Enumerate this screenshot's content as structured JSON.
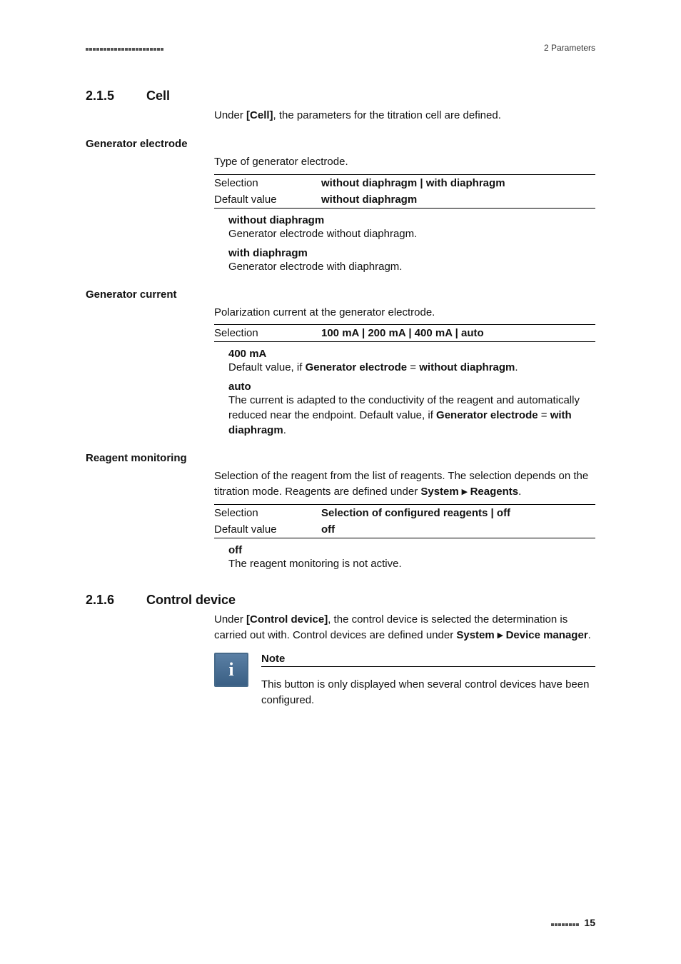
{
  "header": {
    "section_label": "2 Parameters"
  },
  "sections": [
    {
      "number": "2.1.5",
      "title": "Cell",
      "intro": "Under [Cell], the parameters for the titration cell are defined.",
      "intro_bold": "[Cell]",
      "params": [
        {
          "side_heading": "Generator electrode",
          "lead": "Type of generator electrode.",
          "rows": [
            {
              "label": "Selection",
              "value": "without diaphragm | with diaphragm"
            },
            {
              "label": "Default value",
              "value": "without diaphragm"
            }
          ],
          "defs": [
            {
              "term": "without diaphragm",
              "desc": "Generator electrode without diaphragm."
            },
            {
              "term": "with diaphragm",
              "desc": "Generator electrode with diaphragm."
            }
          ]
        },
        {
          "side_heading": "Generator current",
          "lead": "Polarization current at the generator electrode.",
          "rows": [
            {
              "label": "Selection",
              "value": "100 mA | 200 mA | 400 mA | auto"
            }
          ],
          "defs": [
            {
              "term": "400 mA",
              "desc_html": "Default value, if <b>Generator electrode</b> = <b>without diaphragm</b>."
            },
            {
              "term": "auto",
              "desc_html": "The current is adapted to the conductivity of the reagent and automatically reduced near the endpoint. Default value, if <b>Generator electrode</b> = <b>with diaphragm</b>."
            }
          ]
        },
        {
          "side_heading": "Reagent monitoring",
          "lead_html": "Selection of the reagent from the list of reagents. The selection depends on the titration mode. Reagents are defined under <b>System ▸ Reagents</b>.",
          "rows": [
            {
              "label": "Selection",
              "value": "Selection of configured reagents | off"
            },
            {
              "label": "Default value",
              "value": "off"
            }
          ],
          "defs": [
            {
              "term": "off",
              "desc": "The reagent monitoring is not active."
            }
          ]
        }
      ]
    },
    {
      "number": "2.1.6",
      "title": "Control device",
      "intro_html": "Under <b>[Control device]</b>, the control device is selected the determination is carried out with. Control devices are defined under <b>System ▸ Device manager</b>.",
      "note": {
        "title": "Note",
        "body": "This button is only displayed when several control devices have been configured."
      }
    }
  ],
  "footer": {
    "page_number": "15"
  }
}
